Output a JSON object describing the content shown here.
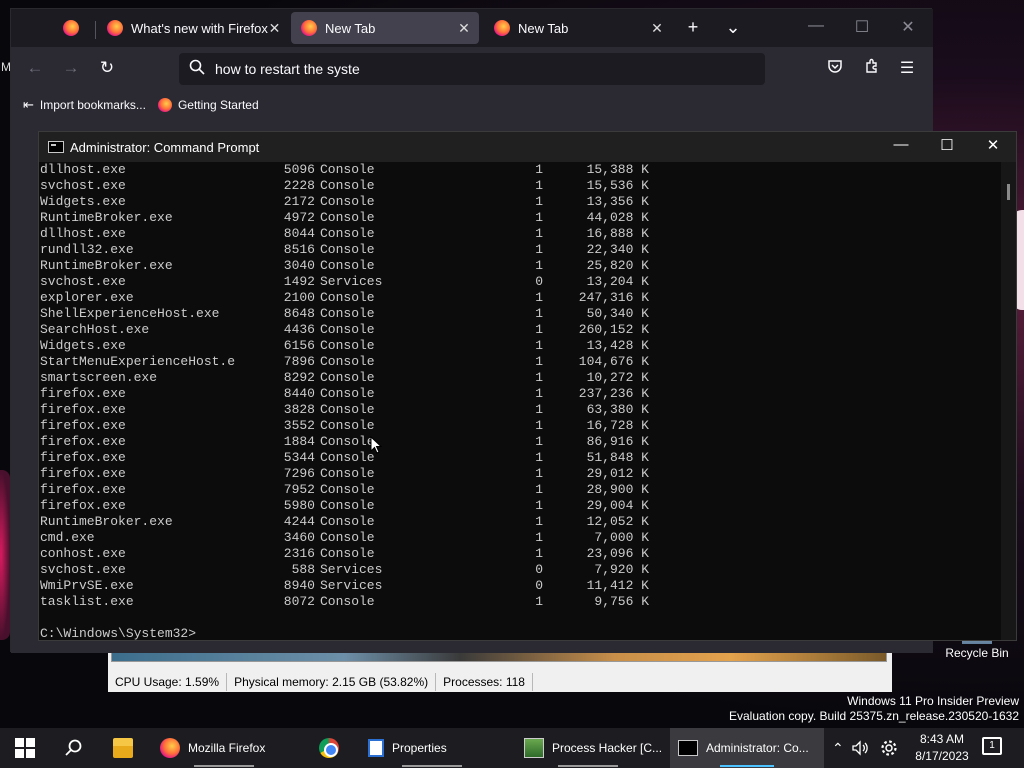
{
  "desktop": {
    "stray_char": "M",
    "recycle_bin": "Recycle Bin",
    "watermark_line1": "Windows 11 Pro Insider Preview",
    "watermark_line2": "Evaluation copy. Build 25375.zn_release.230520-1632"
  },
  "process_hacker": {
    "cpu": "CPU Usage: 1.59%",
    "memory": "Physical memory: 2.15 GB (53.82%)",
    "processes": "Processes: 118"
  },
  "firefox": {
    "tabs": [
      {
        "label": "What's new with Firefox",
        "close": "✕"
      },
      {
        "label": "New Tab",
        "close": "✕"
      },
      {
        "label": "New Tab",
        "close": "✕"
      }
    ],
    "new_tab": "+",
    "list_all": "⌄",
    "url": "how to restart the syste",
    "bookmarks": [
      {
        "label": "Import bookmarks..."
      },
      {
        "label": "Getting Started"
      }
    ]
  },
  "cmd": {
    "title": "Administrator: Command Prompt",
    "rows": [
      {
        "name": "dllhost.exe",
        "pid": "5096",
        "session": "Console",
        "num": "1",
        "mem": "15,388 K"
      },
      {
        "name": "svchost.exe",
        "pid": "2228",
        "session": "Console",
        "num": "1",
        "mem": "15,536 K"
      },
      {
        "name": "Widgets.exe",
        "pid": "2172",
        "session": "Console",
        "num": "1",
        "mem": "13,356 K"
      },
      {
        "name": "RuntimeBroker.exe",
        "pid": "4972",
        "session": "Console",
        "num": "1",
        "mem": "44,028 K"
      },
      {
        "name": "dllhost.exe",
        "pid": "8044",
        "session": "Console",
        "num": "1",
        "mem": "16,888 K"
      },
      {
        "name": "rundll32.exe",
        "pid": "8516",
        "session": "Console",
        "num": "1",
        "mem": "22,340 K"
      },
      {
        "name": "RuntimeBroker.exe",
        "pid": "3040",
        "session": "Console",
        "num": "1",
        "mem": "25,820 K"
      },
      {
        "name": "svchost.exe",
        "pid": "1492",
        "session": "Services",
        "num": "0",
        "mem": "13,204 K"
      },
      {
        "name": "explorer.exe",
        "pid": "2100",
        "session": "Console",
        "num": "1",
        "mem": "247,316 K"
      },
      {
        "name": "ShellExperienceHost.exe",
        "pid": "8648",
        "session": "Console",
        "num": "1",
        "mem": "50,340 K"
      },
      {
        "name": "SearchHost.exe",
        "pid": "4436",
        "session": "Console",
        "num": "1",
        "mem": "260,152 K"
      },
      {
        "name": "Widgets.exe",
        "pid": "6156",
        "session": "Console",
        "num": "1",
        "mem": "13,428 K"
      },
      {
        "name": "StartMenuExperienceHost.e",
        "pid": "7896",
        "session": "Console",
        "num": "1",
        "mem": "104,676 K"
      },
      {
        "name": "smartscreen.exe",
        "pid": "8292",
        "session": "Console",
        "num": "1",
        "mem": "10,272 K"
      },
      {
        "name": "firefox.exe",
        "pid": "8440",
        "session": "Console",
        "num": "1",
        "mem": "237,236 K"
      },
      {
        "name": "firefox.exe",
        "pid": "3828",
        "session": "Console",
        "num": "1",
        "mem": "63,380 K"
      },
      {
        "name": "firefox.exe",
        "pid": "3552",
        "session": "Console",
        "num": "1",
        "mem": "16,728 K"
      },
      {
        "name": "firefox.exe",
        "pid": "1884",
        "session": "Console",
        "num": "1",
        "mem": "86,916 K"
      },
      {
        "name": "firefox.exe",
        "pid": "5344",
        "session": "Console",
        "num": "1",
        "mem": "51,848 K"
      },
      {
        "name": "firefox.exe",
        "pid": "7296",
        "session": "Console",
        "num": "1",
        "mem": "29,012 K"
      },
      {
        "name": "firefox.exe",
        "pid": "7952",
        "session": "Console",
        "num": "1",
        "mem": "28,900 K"
      },
      {
        "name": "firefox.exe",
        "pid": "5980",
        "session": "Console",
        "num": "1",
        "mem": "29,004 K"
      },
      {
        "name": "RuntimeBroker.exe",
        "pid": "4244",
        "session": "Console",
        "num": "1",
        "mem": "12,052 K"
      },
      {
        "name": "cmd.exe",
        "pid": "3460",
        "session": "Console",
        "num": "1",
        "mem": "7,000 K"
      },
      {
        "name": "conhost.exe",
        "pid": "2316",
        "session": "Console",
        "num": "1",
        "mem": "23,096 K"
      },
      {
        "name": "svchost.exe",
        "pid": "588",
        "session": "Services",
        "num": "0",
        "mem": "7,920 K"
      },
      {
        "name": "WmiPrvSE.exe",
        "pid": "8940",
        "session": "Services",
        "num": "0",
        "mem": "11,412 K"
      },
      {
        "name": "tasklist.exe",
        "pid": "8072",
        "session": "Console",
        "num": "1",
        "mem": "9,756 K"
      }
    ],
    "prompt": "C:\\Windows\\System32>"
  },
  "taskbar": {
    "firefox": "Mozilla Firefox",
    "properties": "Properties",
    "process_hacker": "Process Hacker [C...",
    "cmd": "Administrator: Co...",
    "time": "8:43 AM",
    "date": "8/17/2023",
    "notifications": "1"
  }
}
